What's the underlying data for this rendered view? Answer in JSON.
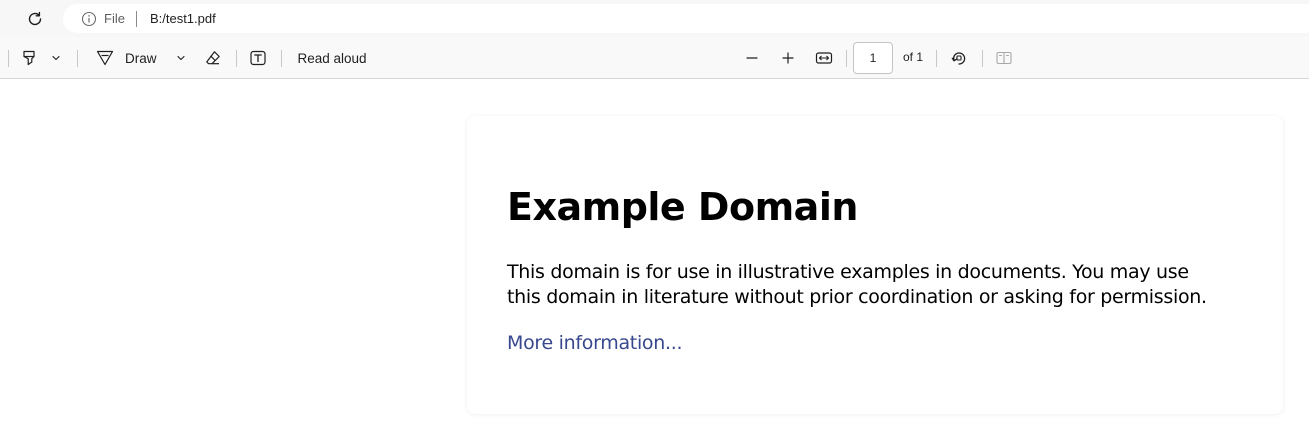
{
  "address_bar": {
    "scheme_label": "File",
    "url": "B:/test1.pdf"
  },
  "pdf_toolbar": {
    "draw_label": "Draw",
    "read_aloud_label": "Read aloud",
    "page_number": "1",
    "page_total_label": "of 1"
  },
  "document": {
    "title": "Example Domain",
    "paragraph": "This domain is for use in illustrative examples in documents. You may use this domain in literature without prior coordination or asking for permission.",
    "link_text": "More information..."
  },
  "colors": {
    "link": "#38488f",
    "toolbar_bg": "#f9f9f9",
    "address_row_bg": "#f7f7f7"
  },
  "icons": {
    "reload": "reload-icon",
    "site_info": "info-icon",
    "highlight": "highlighter-icon",
    "draw": "pen-icon",
    "erase": "eraser-icon",
    "text": "text-box-icon",
    "zoom_out": "minus-icon",
    "zoom_in": "plus-icon",
    "fit": "fit-width-icon",
    "rotate": "rotate-icon",
    "page_view": "two-page-icon"
  }
}
